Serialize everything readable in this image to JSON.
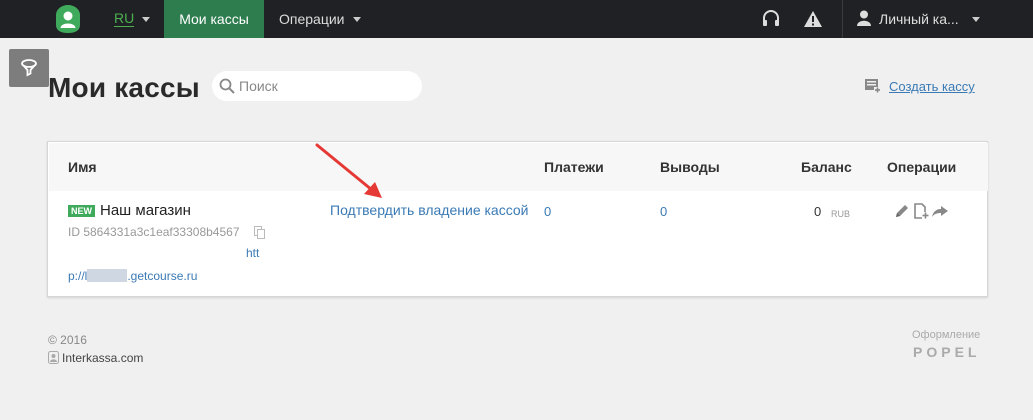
{
  "topbar": {
    "lang": "RU",
    "nav_active": "Мои кассы",
    "nav_operations": "Операции",
    "user_name": "Личный ка..."
  },
  "page": {
    "title": "Мои кассы",
    "search_placeholder": "Поиск",
    "create_label": "Создать кассу"
  },
  "table": {
    "headers": {
      "name": "Имя",
      "payments": "Платежи",
      "withdrawals": "Выводы",
      "balance": "Баланс",
      "operations": "Операции"
    },
    "rows": [
      {
        "badge": "NEW",
        "name": "Наш магазин",
        "id": "ID 5864331a3c1eaf33308b4567",
        "url_line1": "htt",
        "url_prefix": "p://l",
        "url_suffix": ".getcourse.ru",
        "verify_link": "Подтвердить владение кассой",
        "payments": "0",
        "withdrawals": "0",
        "balance": "0",
        "currency": "RUB"
      }
    ]
  },
  "footer": {
    "copyright": "© 2016",
    "company_link": "Interkassa.com",
    "design_label": "Оформление",
    "design_brand": "POPEL"
  },
  "colors": {
    "topbar": "#202124",
    "nav_active": "#2e7d4f",
    "link": "#3a7ab5",
    "badge": "#3faa5b",
    "annotation_arrow": "#e53935"
  },
  "icons": [
    "logo-icon",
    "chevron-down-icon",
    "headset-icon",
    "warning-icon",
    "user-icon",
    "filter-icon",
    "search-icon",
    "create-register-icon",
    "copy-icon",
    "edit-icon",
    "document-icon",
    "share-arrow-icon",
    "interkassa-icon"
  ]
}
